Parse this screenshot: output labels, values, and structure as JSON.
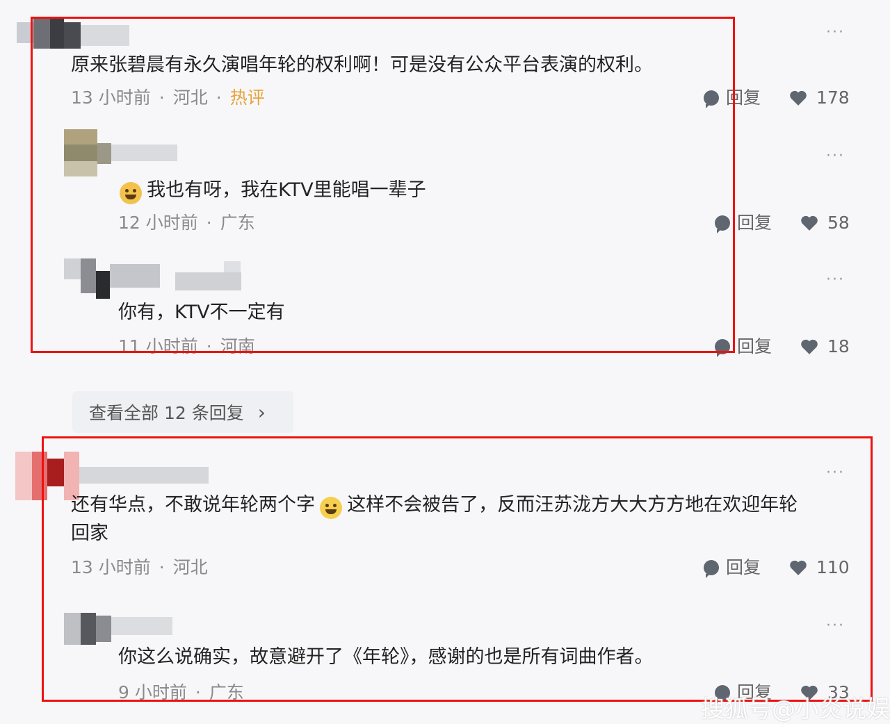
{
  "more_label": "···",
  "comments": [
    {
      "text": "原来张碧晨有永久演唱年轮的权利啊！可是没有公众平台表演的权利。",
      "time": "13 小时前",
      "location": "河北",
      "tag": "热评",
      "reply_label": "回复",
      "likes": "178",
      "replies": [
        {
          "text": "我也有呀，我在KTV里能唱一辈子",
          "time": "12 小时前",
          "location": "广东",
          "reply_label": "回复",
          "likes": "58"
        },
        {
          "text": "你有，KTV不一定有",
          "time": "11 小时前",
          "location": "河南",
          "reply_label": "回复",
          "likes": "18"
        }
      ]
    },
    {
      "text_line1_a": "还有华点，不敢说年轮两个字",
      "text_line1_b": "这样不会被告了，反而汪苏泷方大大方方地在欢迎年轮",
      "text_line2": "回家",
      "time": "13 小时前",
      "location": "河北",
      "reply_label": "回复",
      "likes": "110",
      "replies": [
        {
          "text": "你这么说确实，故意避开了《年轮》，感谢的也是所有词曲作者。",
          "time": "9 小时前",
          "location": "广东",
          "reply_label": "回复",
          "likes": "33"
        }
      ]
    }
  ],
  "view_all": {
    "label": "查看全部 12 条回复",
    "arrow": "›"
  },
  "watermark": "搜狐号@小炎说娱"
}
